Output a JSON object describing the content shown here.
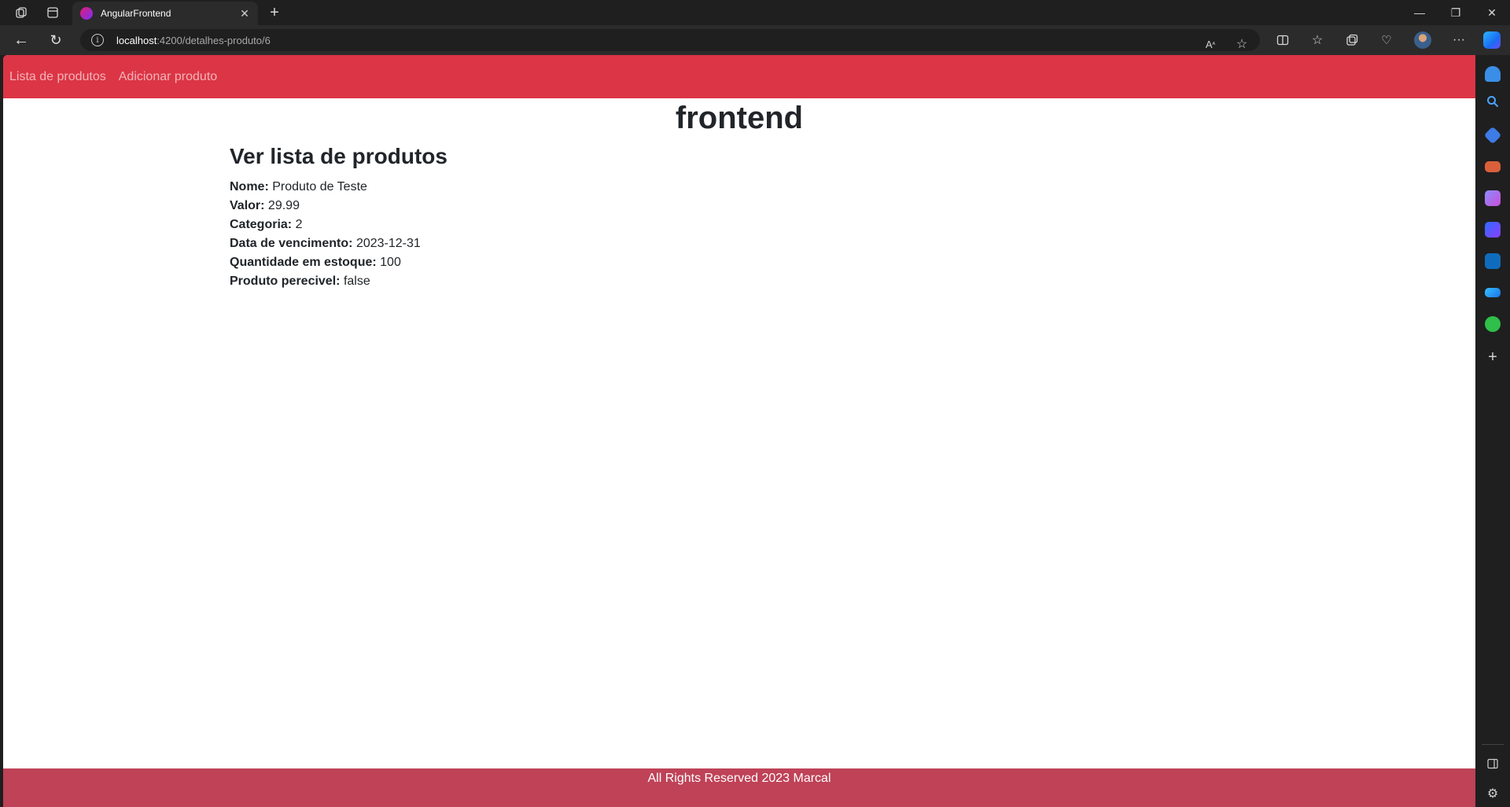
{
  "browser": {
    "tab_title": "AngularFrontend",
    "url_host": "localhost",
    "url_path": ":4200/detalhes-produto/6"
  },
  "navbar": {
    "links": [
      "Lista de produtos",
      "Adicionar produto"
    ],
    "color": "#dc3545"
  },
  "page": {
    "title": "frontend",
    "subtitle": "Ver lista de produtos",
    "fields": [
      {
        "label": "Nome:",
        "value": "Produto de Teste"
      },
      {
        "label": "Valor:",
        "value": "29.99"
      },
      {
        "label": "Categoria:",
        "value": "2"
      },
      {
        "label": "Data de vencimento:",
        "value": "2023-12-31"
      },
      {
        "label": "Quantidade em estoque:",
        "value": "100"
      },
      {
        "label": "Produto perecivel:",
        "value": "false"
      }
    ]
  },
  "footer": {
    "text": "All Rights Reserved 2023 Marcal",
    "color": "#bf4257"
  },
  "icons": {
    "tabbar": [
      "workspaces-icon",
      "tab-actions-icon",
      "new-tab-icon"
    ],
    "toolbar": [
      "read-aloud-icon",
      "favorite-star-icon",
      "split-screen-icon",
      "favorites-icon",
      "collections-icon",
      "browser-essentials-icon",
      "profile-avatar",
      "more-options-icon",
      "copilot-icon"
    ],
    "sidebar": [
      "notifications-icon",
      "search-icon",
      "shopping-icon",
      "tools-icon",
      "games-icon",
      "bing-icon",
      "outlook-icon",
      "drop-icon",
      "tree-icon",
      "add-icon",
      "sidebar-toggle-icon",
      "settings-icon"
    ]
  }
}
